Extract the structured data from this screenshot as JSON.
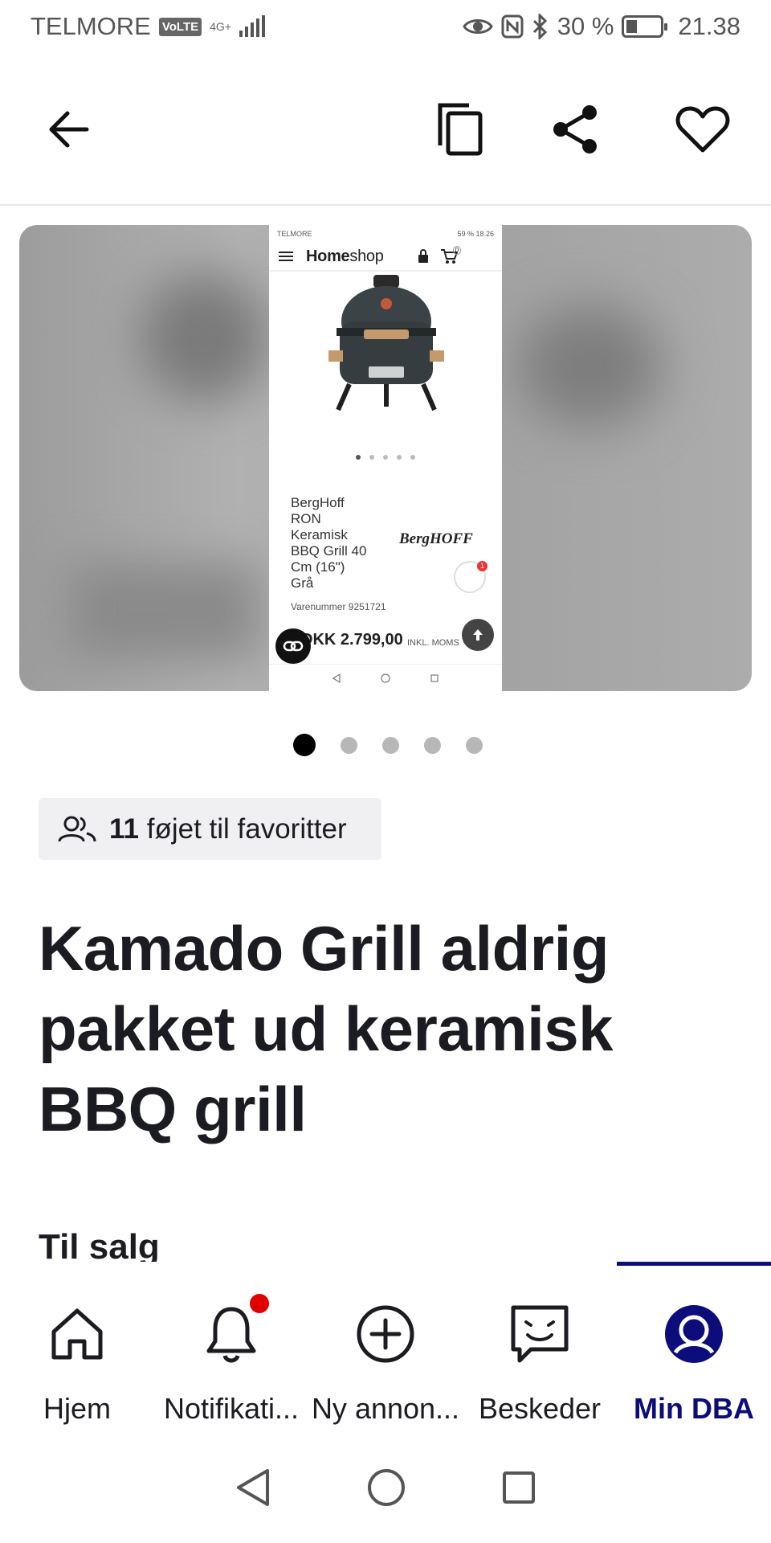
{
  "status_bar": {
    "carrier": "TELMORE",
    "volte": "VoLTE",
    "network": "4G+",
    "battery": "30 %",
    "time": "21.38"
  },
  "screenshot_preview": {
    "status_left": "TELMORE",
    "status_right": "59 % 18.26",
    "store_logo_a": "H",
    "store_logo_b": "ome",
    "store_logo_c": "shop",
    "cart_count": "0",
    "product_title": "BergHoff RON Keramisk BBQ Grill 40 Cm (16\") Grå",
    "brand": "BergHOFF",
    "chat_badge": "1",
    "item_number": "Varenummer 9251721",
    "price": "DKK 2.799,00",
    "price_note": "INKL. MOMS"
  },
  "gallery": {
    "image_count": 5,
    "active_index": 0
  },
  "favorites": {
    "count": "11",
    "label": "føjet til favoritter"
  },
  "listing": {
    "title": "Kamado Grill aldrig pakket ud keramisk BBQ grill",
    "sale_type": "Til salg"
  },
  "bottom_nav": {
    "items": [
      {
        "label": "Hjem",
        "icon": "home-icon"
      },
      {
        "label": "Notifikati...",
        "icon": "bell-icon"
      },
      {
        "label": "Ny annon...",
        "icon": "plus-circle-icon"
      },
      {
        "label": "Beskeder",
        "icon": "chat-icon"
      },
      {
        "label": "Min DBA",
        "icon": "profile-icon"
      }
    ],
    "active_index": 4
  },
  "colors": {
    "accent": "#0c0c7a",
    "notification": "#e00000"
  }
}
